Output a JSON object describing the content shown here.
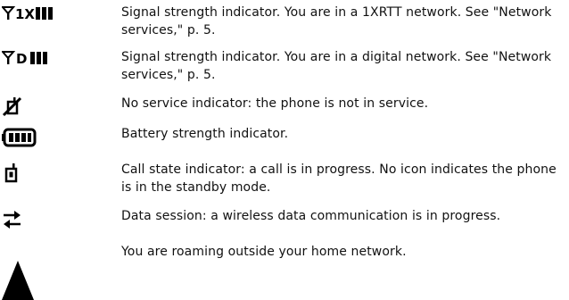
{
  "rows": [
    {
      "icon": "signal-1xrtt-icon",
      "icon_text": "1X",
      "text": "Signal strength indicator. You are in a 1XRTT network. See \"Network services,\" p. 5."
    },
    {
      "icon": "signal-digital-icon",
      "icon_text": "D",
      "text": "Signal strength indicator. You are in a digital network. See \"Network services,\" p. 5."
    },
    {
      "icon": "no-service-icon",
      "text": "No service indicator: the phone is not in service."
    },
    {
      "icon": "battery-icon",
      "text": "Battery strength indicator."
    },
    {
      "icon": "call-state-icon",
      "text": "Call state indicator: a call is in progress. No icon indicates the phone is in the standby mode."
    },
    {
      "icon": "data-session-icon",
      "text": "Data session: a wireless data communication is in progress."
    },
    {
      "icon": "roaming-icon",
      "text": "You are roaming outside your home network."
    }
  ],
  "colors": {
    "text": "#111111",
    "icon": "#000000"
  }
}
